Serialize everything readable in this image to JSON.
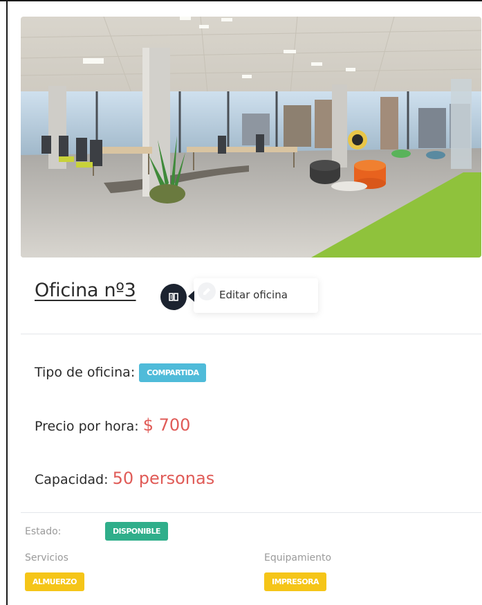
{
  "office": {
    "title": "Oficina nº3",
    "edit_tooltip": "Editar oficina",
    "type_label": "Tipo de oficina:",
    "type_value": "COMPARTIDA",
    "price_label": "Precio por hora:",
    "price_value": "$ 700",
    "capacity_label": "Capacidad:",
    "capacity_value": "50 personas"
  },
  "status": {
    "label": "Estado:",
    "value": "DISPONIBLE"
  },
  "services": {
    "label": "Servicios",
    "items": [
      "ALMUERZO"
    ]
  },
  "equipment": {
    "label": "Equipamiento",
    "items": [
      "IMPRESORA"
    ]
  },
  "icons": {
    "edit": "book-icon",
    "tooltip": "pencil-icon"
  },
  "colors": {
    "price": "#e05b57",
    "badge_info": "#4fbbd9",
    "badge_success": "#2fae8a",
    "badge_warning": "#f5c518",
    "icon_button": "#1c2330"
  }
}
